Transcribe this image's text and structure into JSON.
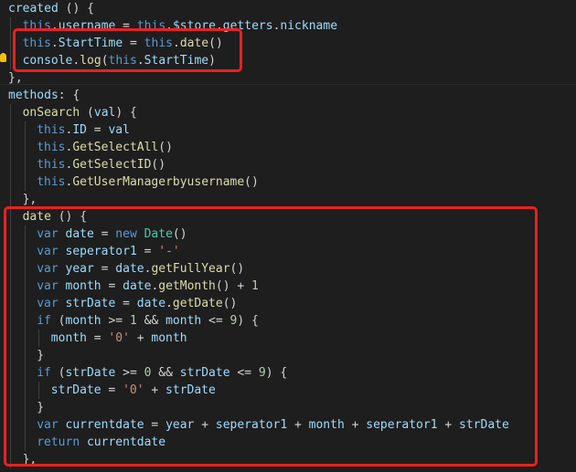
{
  "colors": {
    "background": "#1e1e1e",
    "keyword": "#569cd6",
    "property": "#9cdcfe",
    "function": "#dcdcaa",
    "class": "#4ec9b0",
    "string": "#ce9178",
    "number": "#b5cea8",
    "operator": "#d4d4d4",
    "highlight_box": "#e8221e",
    "lightbulb": "#f2c20f"
  },
  "icons": {
    "lightbulb": "lightbulb-icon"
  },
  "lines": [
    {
      "indent": 0,
      "tokens": [
        {
          "t": "created",
          "c": "property"
        },
        {
          "t": " () {",
          "c": "operator"
        }
      ]
    },
    {
      "indent": 1,
      "tokens": [
        {
          "t": "this",
          "c": "keyword"
        },
        {
          "t": ".",
          "c": "operator"
        },
        {
          "t": "username",
          "c": "property"
        },
        {
          "t": " = ",
          "c": "operator"
        },
        {
          "t": "this",
          "c": "keyword"
        },
        {
          "t": ".",
          "c": "operator"
        },
        {
          "t": "$store",
          "c": "property"
        },
        {
          "t": ".",
          "c": "operator"
        },
        {
          "t": "getters",
          "c": "property"
        },
        {
          "t": ".",
          "c": "operator"
        },
        {
          "t": "nickname",
          "c": "property"
        }
      ]
    },
    {
      "indent": 1,
      "tokens": [
        {
          "t": "this",
          "c": "keyword"
        },
        {
          "t": ".",
          "c": "operator"
        },
        {
          "t": "StartTime",
          "c": "property"
        },
        {
          "t": " = ",
          "c": "operator"
        },
        {
          "t": "this",
          "c": "keyword"
        },
        {
          "t": ".",
          "c": "operator"
        },
        {
          "t": "date",
          "c": "function"
        },
        {
          "t": "()",
          "c": "operator"
        }
      ]
    },
    {
      "indent": 1,
      "tokens": [
        {
          "t": "console",
          "c": "property"
        },
        {
          "t": ".",
          "c": "operator"
        },
        {
          "t": "log",
          "c": "function"
        },
        {
          "t": "(",
          "c": "operator"
        },
        {
          "t": "this",
          "c": "keyword"
        },
        {
          "t": ".",
          "c": "operator"
        },
        {
          "t": "StartTime",
          "c": "property"
        },
        {
          "t": ")",
          "c": "operator"
        }
      ]
    },
    {
      "indent": 0,
      "tokens": [
        {
          "t": "},",
          "c": "operator"
        }
      ]
    },
    {
      "indent": 0,
      "tokens": [
        {
          "t": "methods",
          "c": "property"
        },
        {
          "t": ": {",
          "c": "operator"
        }
      ]
    },
    {
      "indent": 1,
      "tokens": [
        {
          "t": "onSearch",
          "c": "function"
        },
        {
          "t": " (",
          "c": "operator"
        },
        {
          "t": "val",
          "c": "property"
        },
        {
          "t": ") {",
          "c": "operator"
        }
      ]
    },
    {
      "indent": 2,
      "tokens": [
        {
          "t": "this",
          "c": "keyword"
        },
        {
          "t": ".",
          "c": "operator"
        },
        {
          "t": "ID",
          "c": "property"
        },
        {
          "t": " = ",
          "c": "operator"
        },
        {
          "t": "val",
          "c": "property"
        }
      ]
    },
    {
      "indent": 2,
      "tokens": [
        {
          "t": "this",
          "c": "keyword"
        },
        {
          "t": ".",
          "c": "operator"
        },
        {
          "t": "GetSelectAll",
          "c": "function"
        },
        {
          "t": "()",
          "c": "operator"
        }
      ]
    },
    {
      "indent": 2,
      "tokens": [
        {
          "t": "this",
          "c": "keyword"
        },
        {
          "t": ".",
          "c": "operator"
        },
        {
          "t": "GetSelectID",
          "c": "function"
        },
        {
          "t": "()",
          "c": "operator"
        }
      ]
    },
    {
      "indent": 2,
      "tokens": [
        {
          "t": "this",
          "c": "keyword"
        },
        {
          "t": ".",
          "c": "operator"
        },
        {
          "t": "GetUserManagerbyusername",
          "c": "function"
        },
        {
          "t": "()",
          "c": "operator"
        }
      ]
    },
    {
      "indent": 1,
      "tokens": [
        {
          "t": "},",
          "c": "operator"
        }
      ]
    },
    {
      "indent": 1,
      "tokens": [
        {
          "t": "date",
          "c": "function"
        },
        {
          "t": " () {",
          "c": "operator"
        }
      ]
    },
    {
      "indent": 2,
      "tokens": [
        {
          "t": "var",
          "c": "keyword"
        },
        {
          "t": " ",
          "c": "operator"
        },
        {
          "t": "date",
          "c": "property"
        },
        {
          "t": " = ",
          "c": "operator"
        },
        {
          "t": "new",
          "c": "keyword"
        },
        {
          "t": " ",
          "c": "operator"
        },
        {
          "t": "Date",
          "c": "class"
        },
        {
          "t": "()",
          "c": "operator"
        }
      ]
    },
    {
      "indent": 2,
      "tokens": [
        {
          "t": "var",
          "c": "keyword"
        },
        {
          "t": " ",
          "c": "operator"
        },
        {
          "t": "seperator1",
          "c": "property"
        },
        {
          "t": " = ",
          "c": "operator"
        },
        {
          "t": "'-'",
          "c": "string"
        }
      ]
    },
    {
      "indent": 2,
      "tokens": [
        {
          "t": "var",
          "c": "keyword"
        },
        {
          "t": " ",
          "c": "operator"
        },
        {
          "t": "year",
          "c": "property"
        },
        {
          "t": " = ",
          "c": "operator"
        },
        {
          "t": "date",
          "c": "property"
        },
        {
          "t": ".",
          "c": "operator"
        },
        {
          "t": "getFullYear",
          "c": "function"
        },
        {
          "t": "()",
          "c": "operator"
        }
      ]
    },
    {
      "indent": 2,
      "tokens": [
        {
          "t": "var",
          "c": "keyword"
        },
        {
          "t": " ",
          "c": "operator"
        },
        {
          "t": "month",
          "c": "property"
        },
        {
          "t": " = ",
          "c": "operator"
        },
        {
          "t": "date",
          "c": "property"
        },
        {
          "t": ".",
          "c": "operator"
        },
        {
          "t": "getMonth",
          "c": "function"
        },
        {
          "t": "() + ",
          "c": "operator"
        },
        {
          "t": "1",
          "c": "number"
        }
      ]
    },
    {
      "indent": 2,
      "tokens": [
        {
          "t": "var",
          "c": "keyword"
        },
        {
          "t": " ",
          "c": "operator"
        },
        {
          "t": "strDate",
          "c": "property"
        },
        {
          "t": " = ",
          "c": "operator"
        },
        {
          "t": "date",
          "c": "property"
        },
        {
          "t": ".",
          "c": "operator"
        },
        {
          "t": "getDate",
          "c": "function"
        },
        {
          "t": "()",
          "c": "operator"
        }
      ]
    },
    {
      "indent": 2,
      "tokens": [
        {
          "t": "if",
          "c": "keyword"
        },
        {
          "t": " (",
          "c": "operator"
        },
        {
          "t": "month",
          "c": "property"
        },
        {
          "t": " >= ",
          "c": "operator"
        },
        {
          "t": "1",
          "c": "number"
        },
        {
          "t": " && ",
          "c": "operator"
        },
        {
          "t": "month",
          "c": "property"
        },
        {
          "t": " <= ",
          "c": "operator"
        },
        {
          "t": "9",
          "c": "number"
        },
        {
          "t": ") {",
          "c": "operator"
        }
      ]
    },
    {
      "indent": 3,
      "tokens": [
        {
          "t": "month",
          "c": "property"
        },
        {
          "t": " = ",
          "c": "operator"
        },
        {
          "t": "'0'",
          "c": "string"
        },
        {
          "t": " + ",
          "c": "operator"
        },
        {
          "t": "month",
          "c": "property"
        }
      ]
    },
    {
      "indent": 2,
      "tokens": [
        {
          "t": "}",
          "c": "operator"
        }
      ]
    },
    {
      "indent": 2,
      "tokens": [
        {
          "t": "if",
          "c": "keyword"
        },
        {
          "t": " (",
          "c": "operator"
        },
        {
          "t": "strDate",
          "c": "property"
        },
        {
          "t": " >= ",
          "c": "operator"
        },
        {
          "t": "0",
          "c": "number"
        },
        {
          "t": " && ",
          "c": "operator"
        },
        {
          "t": "strDate",
          "c": "property"
        },
        {
          "t": " <= ",
          "c": "operator"
        },
        {
          "t": "9",
          "c": "number"
        },
        {
          "t": ") {",
          "c": "operator"
        }
      ]
    },
    {
      "indent": 3,
      "tokens": [
        {
          "t": "strDate",
          "c": "property"
        },
        {
          "t": " = ",
          "c": "operator"
        },
        {
          "t": "'0'",
          "c": "string"
        },
        {
          "t": " + ",
          "c": "operator"
        },
        {
          "t": "strDate",
          "c": "property"
        }
      ]
    },
    {
      "indent": 2,
      "tokens": [
        {
          "t": "}",
          "c": "operator"
        }
      ]
    },
    {
      "indent": 2,
      "tokens": [
        {
          "t": "var",
          "c": "keyword"
        },
        {
          "t": " ",
          "c": "operator"
        },
        {
          "t": "currentdate",
          "c": "property"
        },
        {
          "t": " = ",
          "c": "operator"
        },
        {
          "t": "year",
          "c": "property"
        },
        {
          "t": " + ",
          "c": "operator"
        },
        {
          "t": "seperator1",
          "c": "property"
        },
        {
          "t": " + ",
          "c": "operator"
        },
        {
          "t": "month",
          "c": "property"
        },
        {
          "t": " + ",
          "c": "operator"
        },
        {
          "t": "seperator1",
          "c": "property"
        },
        {
          "t": " + ",
          "c": "operator"
        },
        {
          "t": "strDate",
          "c": "property"
        }
      ]
    },
    {
      "indent": 2,
      "tokens": [
        {
          "t": "return",
          "c": "keyword"
        },
        {
          "t": " ",
          "c": "operator"
        },
        {
          "t": "currentdate",
          "c": "property"
        }
      ]
    },
    {
      "indent": 1,
      "tokens": [
        {
          "t": "},",
          "c": "operator"
        }
      ]
    }
  ],
  "highlights": [
    {
      "name": "starttime-highlight-box",
      "from": 2,
      "to": 3
    },
    {
      "name": "date-method-highlight-box",
      "from": 12,
      "to": 26
    }
  ]
}
